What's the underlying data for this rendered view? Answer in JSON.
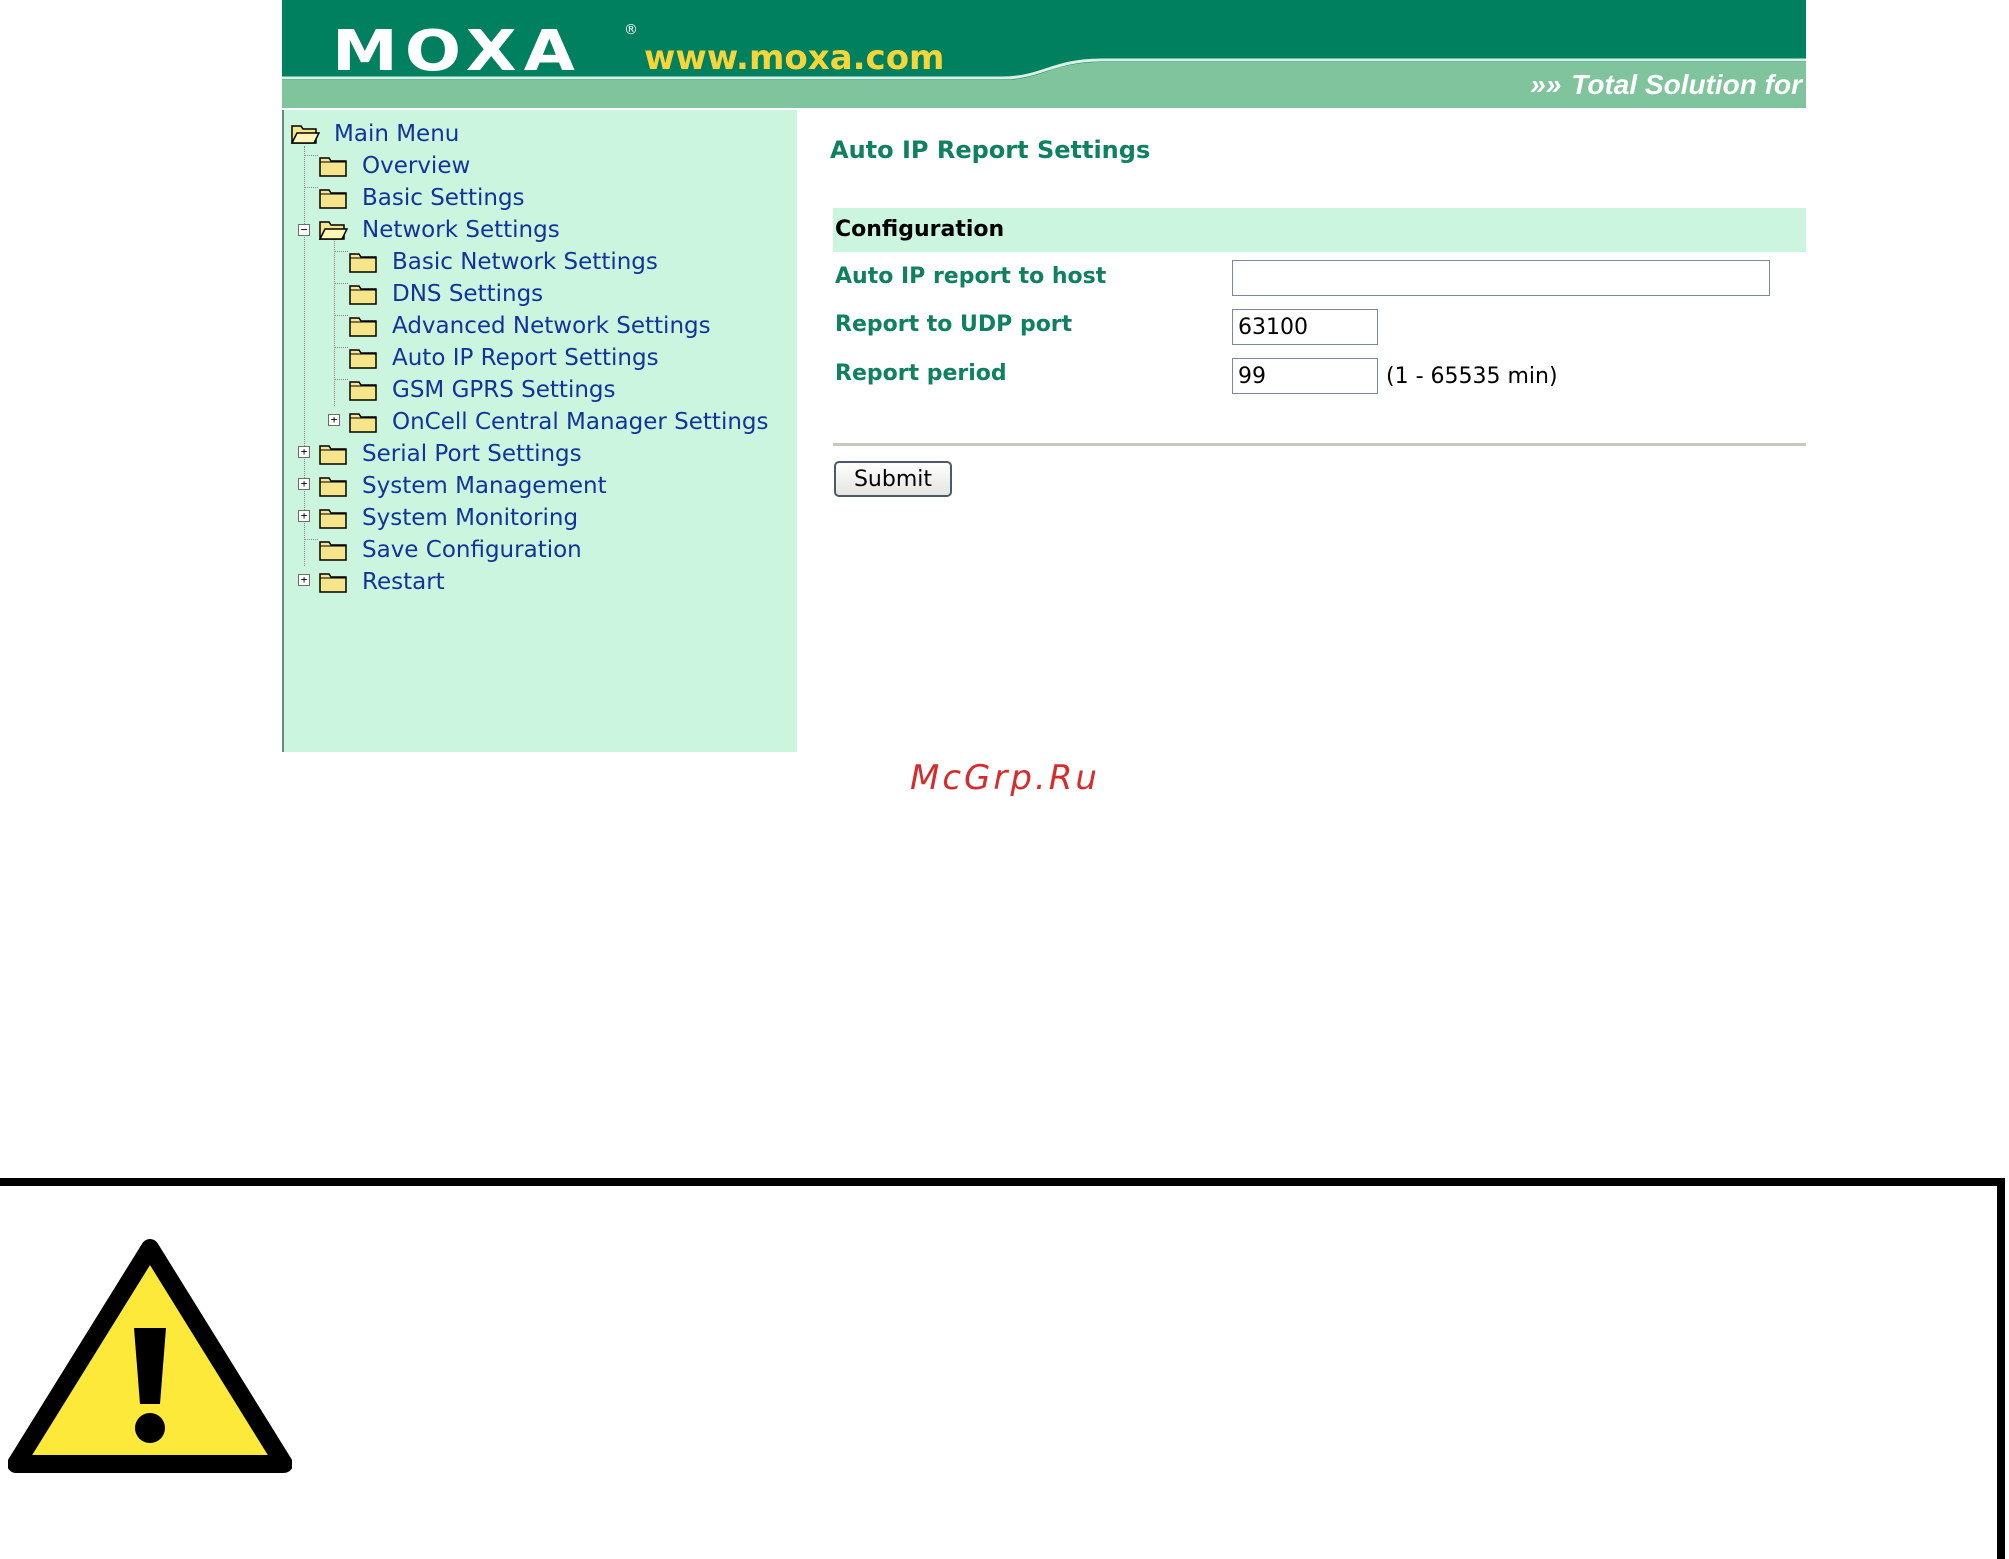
{
  "header": {
    "logo": "MOXA",
    "registered_mark": "®",
    "url": "www.moxa.com",
    "tagline_arrows": "»»",
    "tagline": "Total Solution for"
  },
  "sidebar": {
    "items": [
      {
        "label": "Main Menu",
        "icon": "open-folder-icon"
      },
      {
        "label": "Overview",
        "icon": "folder-icon"
      },
      {
        "label": "Basic Settings",
        "icon": "folder-icon"
      },
      {
        "label": "Network Settings",
        "icon": "open-folder-icon",
        "expanded": true
      },
      {
        "label": "Basic Network Settings",
        "icon": "folder-icon"
      },
      {
        "label": "DNS Settings",
        "icon": "folder-icon"
      },
      {
        "label": "Advanced Network Settings",
        "icon": "folder-icon"
      },
      {
        "label": "Auto IP Report Settings",
        "icon": "folder-icon"
      },
      {
        "label": "GSM GPRS Settings",
        "icon": "folder-icon"
      },
      {
        "label": "OnCell Central Manager Settings",
        "icon": "folder-icon",
        "expandable": true
      },
      {
        "label": "Serial Port Settings",
        "icon": "folder-icon",
        "expandable": true
      },
      {
        "label": "System Management",
        "icon": "folder-icon",
        "expandable": true
      },
      {
        "label": "System Monitoring",
        "icon": "folder-icon",
        "expandable": true
      },
      {
        "label": "Save Configuration",
        "icon": "folder-icon"
      },
      {
        "label": "Restart",
        "icon": "folder-icon",
        "expandable": true
      }
    ]
  },
  "main": {
    "title": "Auto IP Report Settings",
    "section_header": "Configuration",
    "fields": [
      {
        "label": "Auto IP report to host",
        "value": ""
      },
      {
        "label": "Report to UDP port",
        "value": "63100"
      },
      {
        "label": "Report period",
        "value": "99",
        "hint": "(1 - 65535 min)"
      }
    ],
    "submit_label": "Submit"
  },
  "watermark": "McGrp.Ru",
  "colors": {
    "header_dark": "#00805f",
    "header_light": "#7fc49c",
    "sidebar_bg": "#ccf5df",
    "link": "#12349a",
    "label": "#0f8060",
    "warning_yellow": "#fde93a"
  }
}
